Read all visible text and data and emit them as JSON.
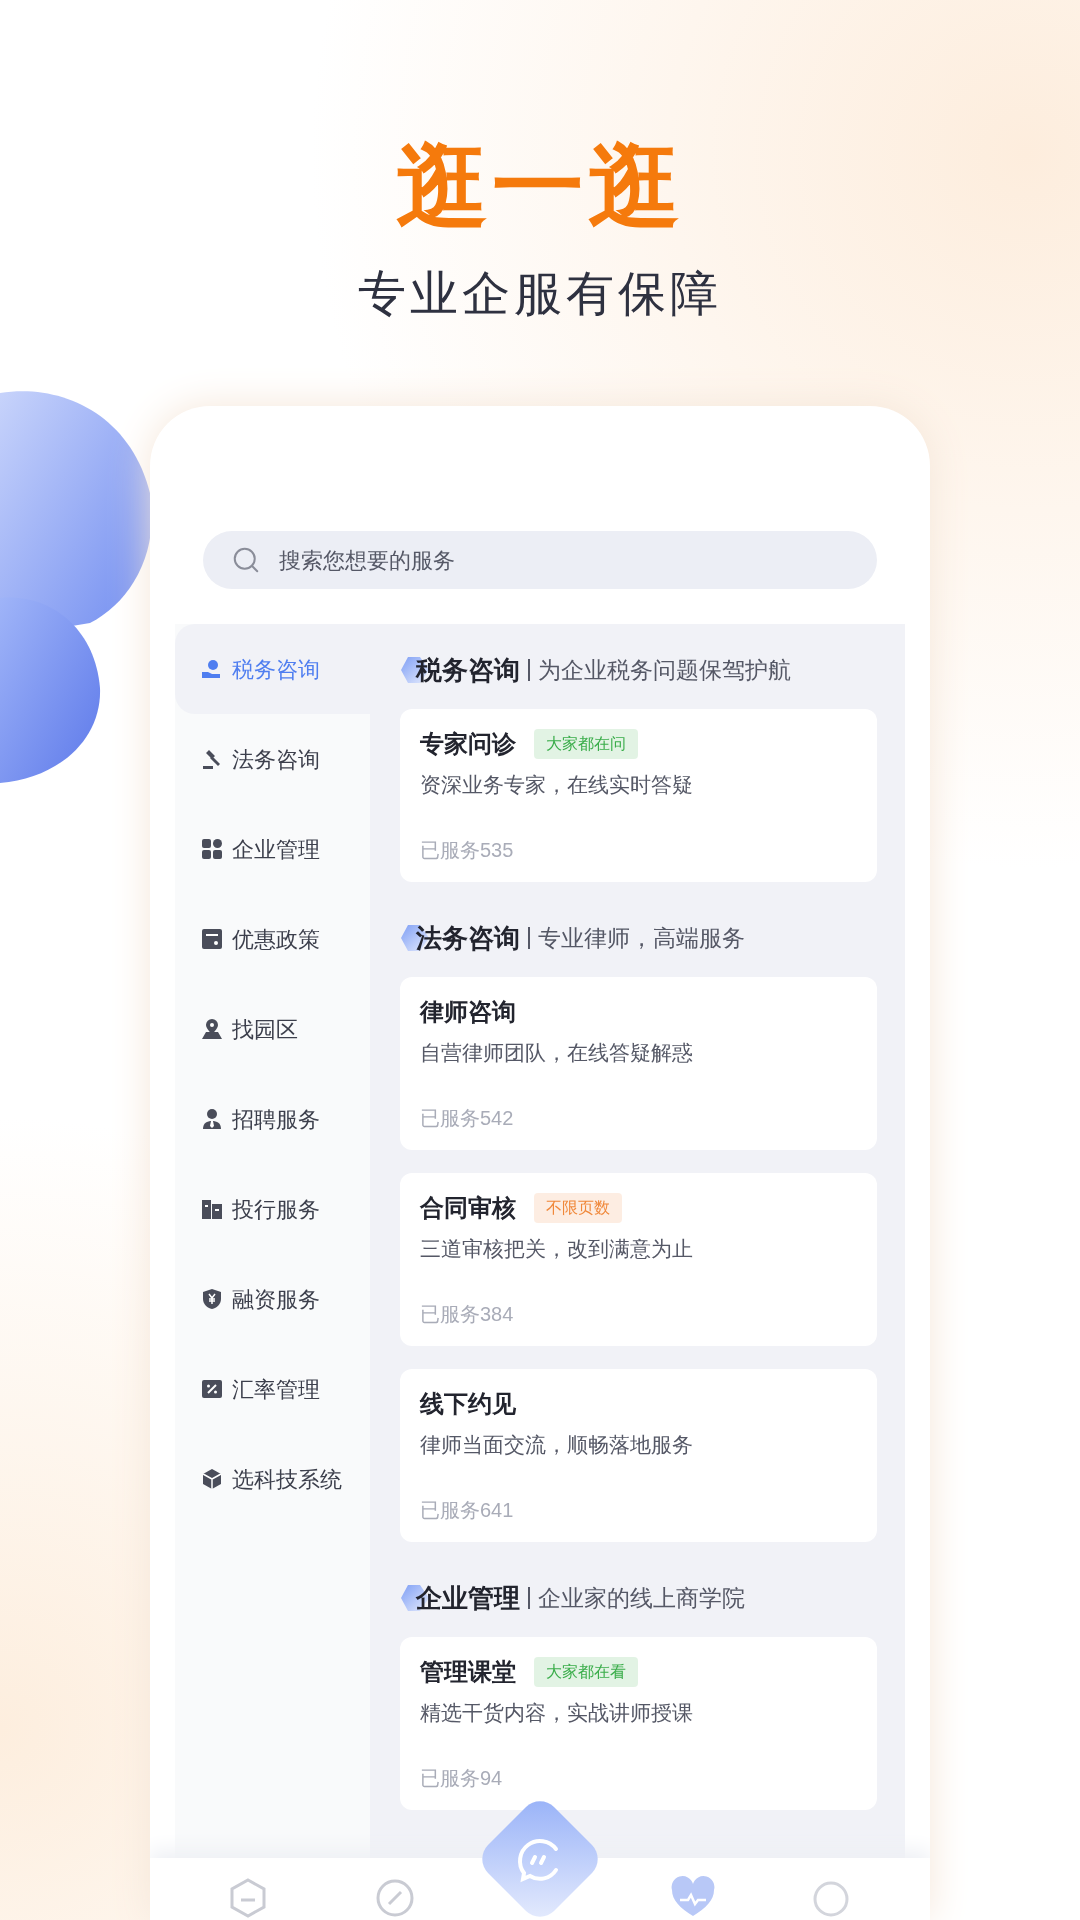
{
  "headline": "逛一逛",
  "subtitle": "专业企服有保障",
  "search": {
    "placeholder": "搜索您想要的服务"
  },
  "sidebar": {
    "items": [
      {
        "label": "税务咨询",
        "selected": true
      },
      {
        "label": "法务咨询",
        "selected": false
      },
      {
        "label": "企业管理",
        "selected": false
      },
      {
        "label": "优惠政策",
        "selected": false
      },
      {
        "label": "找园区",
        "selected": false
      },
      {
        "label": "招聘服务",
        "selected": false
      },
      {
        "label": "投行服务",
        "selected": false
      },
      {
        "label": "融资服务",
        "selected": false
      },
      {
        "label": "汇率管理",
        "selected": false
      },
      {
        "label": "选科技系统",
        "selected": false
      }
    ]
  },
  "sections": [
    {
      "title": "税务咨询",
      "subtitle": "为企业税务问题保驾护航",
      "cards": [
        {
          "title": "专家问诊",
          "badge": {
            "text": "大家都在问",
            "color": "#3aad4a"
          },
          "desc": "资深业务专家，在线实时答疑",
          "count": "已服务535"
        }
      ]
    },
    {
      "title": "法务咨询",
      "subtitle": "专业律师，高端服务",
      "cards": [
        {
          "title": "律师咨询",
          "desc": "自营律师团队，在线答疑解惑",
          "count": "已服务542"
        },
        {
          "title": "合同审核",
          "badge": {
            "text": "不限页数",
            "color": "#f0883a"
          },
          "desc": "三道审核把关，改到满意为止",
          "count": "已服务384"
        },
        {
          "title": "线下约见",
          "desc": "律师当面交流，顺畅落地服务",
          "count": "已服务641"
        }
      ]
    },
    {
      "title": "企业管理",
      "subtitle": "企业家的线上商学院",
      "cards": [
        {
          "title": "管理课堂",
          "badge": {
            "text": "大家都在看",
            "color": "#3aad4a"
          },
          "desc": "精选干货内容，实战讲师授课",
          "count": "已服务94"
        }
      ]
    }
  ]
}
